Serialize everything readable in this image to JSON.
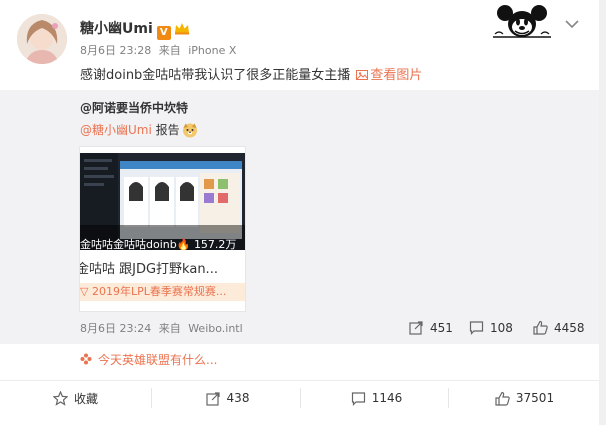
{
  "post": {
    "author": "糖小幽Umi",
    "verified_badge": "V",
    "date": "8月6日 23:28",
    "source_prefix": "来自",
    "source": "iPhone X",
    "content": "感谢doinb金咕咕带我认识了很多正能量女主播",
    "view_pics": "查看图片"
  },
  "repost": {
    "author": "@阿诺要当侨中坎特",
    "mention": "@糖小幽Umi",
    "text": "报告",
    "video_meta": "金咕咕金咕咕doinb",
    "video_views": "157.2万",
    "card_title": "金咕咕 跟JDG打野kan...",
    "card_banner": "2019年LPL春季赛常规赛...",
    "date": "8月6日 23:24",
    "source_prefix": "来自",
    "source": "Weibo.intl",
    "reposts": "451",
    "comments": "108",
    "likes": "4458"
  },
  "topic": {
    "text": "今天英雄联盟有什么..."
  },
  "actions": {
    "favorite": "收藏",
    "repost": "438",
    "comment": "1146",
    "like": "37501"
  },
  "colors": {
    "accent": "#eb7350",
    "repost_bg": "#f2f2f5",
    "badge": "#f08a12"
  }
}
